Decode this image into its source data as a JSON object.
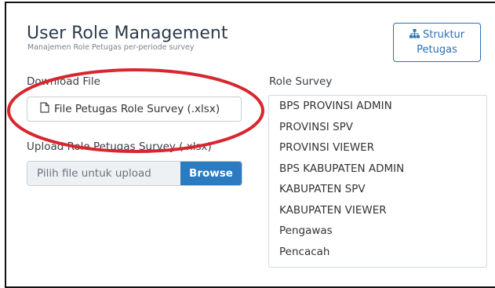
{
  "header": {
    "title": "User Role Management",
    "subtitle": "Manajemen Role Petugas per-periode survey",
    "struktur_button": {
      "icon": "sitemap-icon",
      "line1": "Struktur",
      "line2": "Petugas"
    }
  },
  "download": {
    "label": "Download File",
    "button_label": "File Petugas Role Survey (.xlsx)",
    "icon": "file-icon"
  },
  "upload": {
    "label": "Upload Role Petugas Survey (.xlsx)",
    "placeholder": "Pilih file untuk upload",
    "browse_label": "Browse"
  },
  "roles": {
    "label": "Role Survey",
    "items": [
      "BPS PROVINSI ADMIN",
      "PROVINSI SPV",
      "PROVINSI VIEWER",
      "BPS KABUPATEN ADMIN",
      "KABUPATEN SPV",
      "KABUPATEN VIEWER",
      "Pengawas",
      "Pencacah"
    ]
  },
  "colors": {
    "accent": "#2a7bc0",
    "highlight_ellipse": "#d8262e"
  }
}
